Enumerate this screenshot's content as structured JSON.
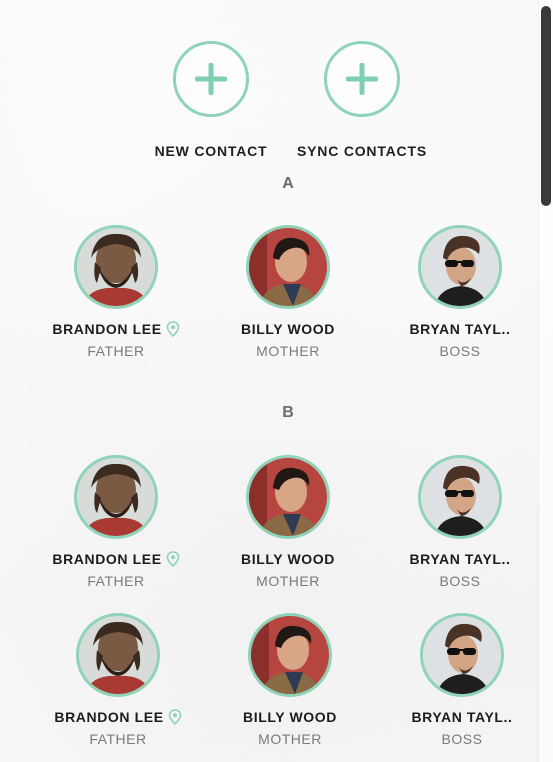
{
  "actions": {
    "new_contact": {
      "label": "NEW CONTACT",
      "icon": "plus-icon"
    },
    "sync_contacts": {
      "label": "SYNC CONTACTS",
      "icon": "plus-icon"
    }
  },
  "sections": [
    {
      "letter": "A",
      "contacts": [
        {
          "name": "BRANDON LEE",
          "role": "FATHER",
          "has_location": true,
          "avatar": "bearded-man-avatar"
        },
        {
          "name": "BILLY WOOD",
          "role": "MOTHER",
          "has_location": false,
          "avatar": "dark-hair-man-avatar"
        },
        {
          "name": "BRYAN TAYL..",
          "role": "BOSS",
          "has_location": false,
          "avatar": "sunglasses-man-avatar"
        }
      ]
    },
    {
      "letter": "B",
      "contacts": [
        {
          "name": "BRANDON LEE",
          "role": "FATHER",
          "has_location": true,
          "avatar": "bearded-man-avatar"
        },
        {
          "name": "BILLY WOOD",
          "role": "MOTHER",
          "has_location": false,
          "avatar": "dark-hair-man-avatar"
        },
        {
          "name": "BRYAN TAYL..",
          "role": "BOSS",
          "has_location": false,
          "avatar": "sunglasses-man-avatar"
        },
        {
          "name": "BRANDON LEE",
          "role": "FATHER",
          "has_location": true,
          "avatar": "bearded-man-avatar"
        },
        {
          "name": "BILLY WOOD",
          "role": "MOTHER",
          "has_location": false,
          "avatar": "dark-hair-man-avatar"
        },
        {
          "name": "BRYAN TAYL..",
          "role": "BOSS",
          "has_location": false,
          "avatar": "sunglasses-man-avatar"
        }
      ]
    }
  ],
  "colors": {
    "accent": "#8fd3b8",
    "text_primary": "#1c1c1c",
    "text_secondary": "#7a7a7a"
  }
}
